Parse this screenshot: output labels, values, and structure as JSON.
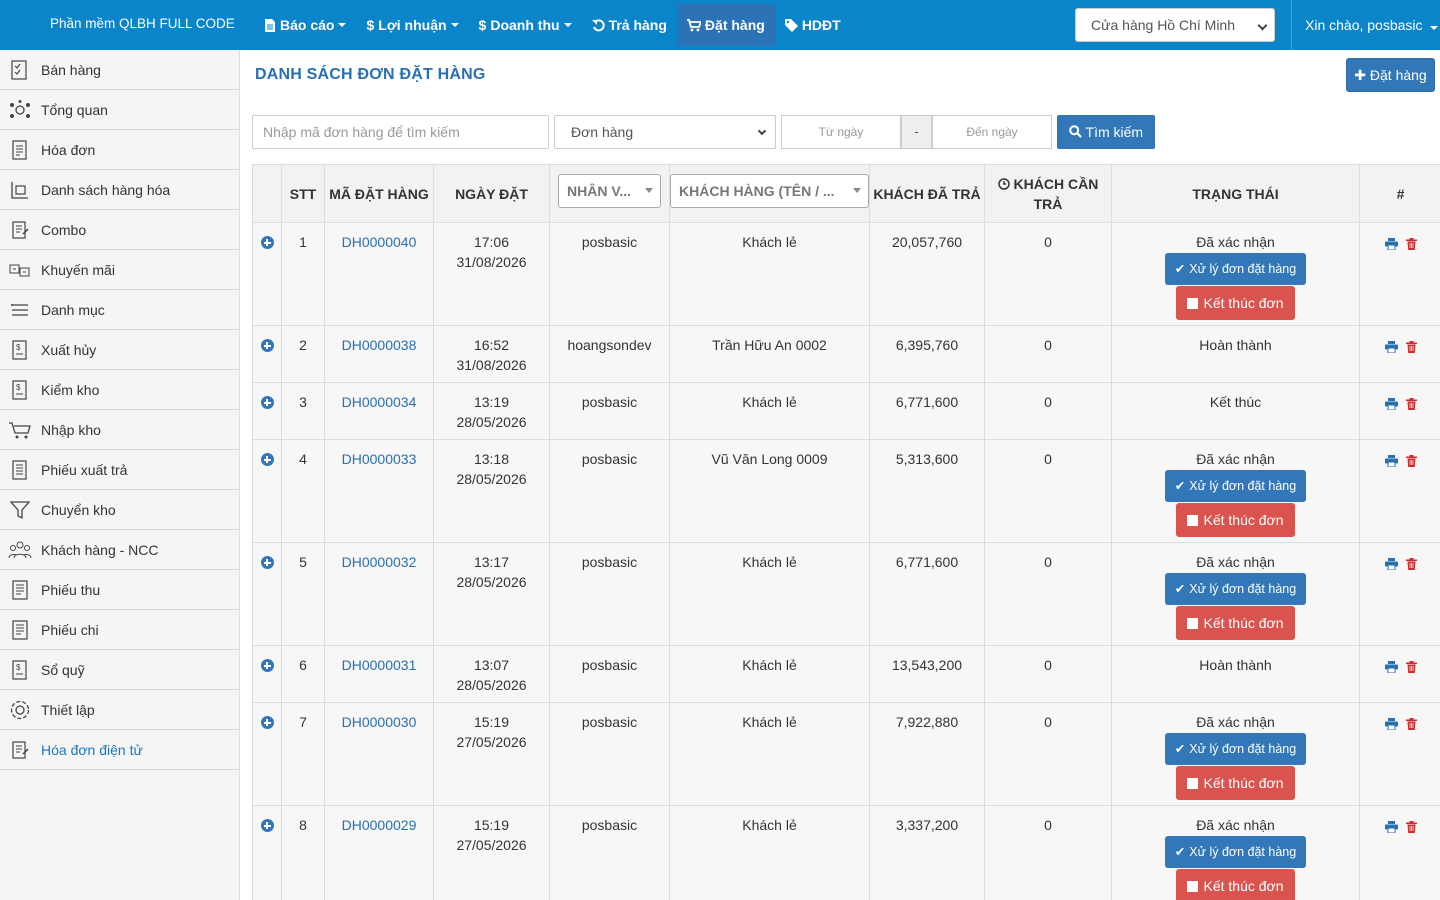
{
  "topbar": {
    "brand": "Phần mềm QLBH FULL CODE",
    "nav": [
      {
        "label": "Báo cáo",
        "icon": "file-icon",
        "caret": true
      },
      {
        "label": "Lợi nhuận",
        "icon": "dollar-icon",
        "caret": true
      },
      {
        "label": "Doanh thu",
        "icon": "dollar-icon",
        "caret": true
      },
      {
        "label": "Trả hàng",
        "icon": "undo-icon",
        "caret": false
      },
      {
        "label": "Đặt hàng",
        "icon": "cart-icon",
        "caret": false,
        "active": true
      },
      {
        "label": "HDĐT",
        "icon": "tag-icon",
        "caret": false
      }
    ],
    "store": "Cửa hàng Hồ Chí Minh",
    "greeting": "Xin chào, posbasic"
  },
  "sidebar": {
    "items": [
      {
        "label": "Bán hàng",
        "icon": "sales-icon"
      },
      {
        "label": "Tổng quan",
        "icon": "overview-icon"
      },
      {
        "label": "Hóa đơn",
        "icon": "invoice-icon"
      },
      {
        "label": "Danh sách hàng hóa",
        "icon": "products-icon"
      },
      {
        "label": "Combo",
        "icon": "combo-icon"
      },
      {
        "label": "Khuyến mãi",
        "icon": "promotion-icon"
      },
      {
        "label": "Danh mục",
        "icon": "list-icon"
      },
      {
        "label": "Xuất hủy",
        "icon": "dispose-icon"
      },
      {
        "label": "Kiểm kho",
        "icon": "stock-check-icon"
      },
      {
        "label": "Nhập kho",
        "icon": "import-icon"
      },
      {
        "label": "Phiếu xuất trả",
        "icon": "return-slip-icon"
      },
      {
        "label": "Chuyển kho",
        "icon": "transfer-icon"
      },
      {
        "label": "Khách hàng - NCC",
        "icon": "customers-icon"
      },
      {
        "label": "Phiếu thu",
        "icon": "receipt-icon"
      },
      {
        "label": "Phiếu chi",
        "icon": "payment-icon"
      },
      {
        "label": "Sổ quỹ",
        "icon": "cashbook-icon"
      },
      {
        "label": "Thiết lập",
        "icon": "settings-icon"
      },
      {
        "label": "Hóa đơn điện tử",
        "icon": "e-invoice-icon",
        "highlight": true
      }
    ]
  },
  "main": {
    "title": "DANH SÁCH ĐƠN ĐẶT HÀNG",
    "add_button": "Đặt hàng",
    "search_placeholder": "Nhập mã đơn hàng để tìm kiếm",
    "order_select": "Đơn hàng",
    "date_from": "Từ ngày",
    "date_sep": "-",
    "date_to": "Đến ngày",
    "search_button": "Tìm kiếm"
  },
  "table": {
    "headers": {
      "stt": "STT",
      "code": "MÃ ĐẶT HÀNG",
      "date": "NGÀY ĐẶT",
      "staff_filter": "NHÂN V...",
      "customer_filter": "KHÁCH HÀNG (TÊN / ...",
      "paid": "KHÁCH ĐÃ TRẢ",
      "due": "KHÁCH CẦN TRẢ",
      "status": "TRẠNG THÁI",
      "actions": "#"
    },
    "process_label": "Xử lý đơn đặt hàng",
    "end_label": "Kết thúc đơn",
    "rows": [
      {
        "stt": "1",
        "code": "DH0000040",
        "time": "17:06",
        "date": "31/08/2026",
        "staff": "posbasic",
        "customer": "Khách lẻ",
        "paid": "20,057,760",
        "due": "0",
        "status": "Đã xác nhận",
        "actions": true
      },
      {
        "stt": "2",
        "code": "DH0000038",
        "time": "16:52",
        "date": "31/08/2026",
        "staff": "hoangsondev",
        "customer": "Trần Hữu An 0002",
        "paid": "6,395,760",
        "due": "0",
        "status": "Hoàn thành",
        "actions": false
      },
      {
        "stt": "3",
        "code": "DH0000034",
        "time": "13:19",
        "date": "28/05/2026",
        "staff": "posbasic",
        "customer": "Khách lẻ",
        "paid": "6,771,600",
        "due": "0",
        "status": "Kết thúc",
        "actions": false
      },
      {
        "stt": "4",
        "code": "DH0000033",
        "time": "13:18",
        "date": "28/05/2026",
        "staff": "posbasic",
        "customer": "Vũ Văn Long 0009",
        "paid": "5,313,600",
        "due": "0",
        "status": "Đã xác nhận",
        "actions": true
      },
      {
        "stt": "5",
        "code": "DH0000032",
        "time": "13:17",
        "date": "28/05/2026",
        "staff": "posbasic",
        "customer": "Khách lẻ",
        "paid": "6,771,600",
        "due": "0",
        "status": "Đã xác nhận",
        "actions": true
      },
      {
        "stt": "6",
        "code": "DH0000031",
        "time": "13:07",
        "date": "28/05/2026",
        "staff": "posbasic",
        "customer": "Khách lẻ",
        "paid": "13,543,200",
        "due": "0",
        "status": "Hoàn thành",
        "actions": false
      },
      {
        "stt": "7",
        "code": "DH0000030",
        "time": "15:19",
        "date": "27/05/2026",
        "staff": "posbasic",
        "customer": "Khách lẻ",
        "paid": "7,922,880",
        "due": "0",
        "status": "Đã xác nhận",
        "actions": true
      },
      {
        "stt": "8",
        "code": "DH0000029",
        "time": "15:19",
        "date": "27/05/2026",
        "staff": "posbasic",
        "customer": "Khách lẻ",
        "paid": "3,337,200",
        "due": "0",
        "status": "Đã xác nhận",
        "actions": true
      }
    ]
  },
  "colors": {
    "topbar": "#0a85c9",
    "primary": "#3277b7",
    "danger": "#d9534f",
    "link": "#2a6fb0"
  }
}
